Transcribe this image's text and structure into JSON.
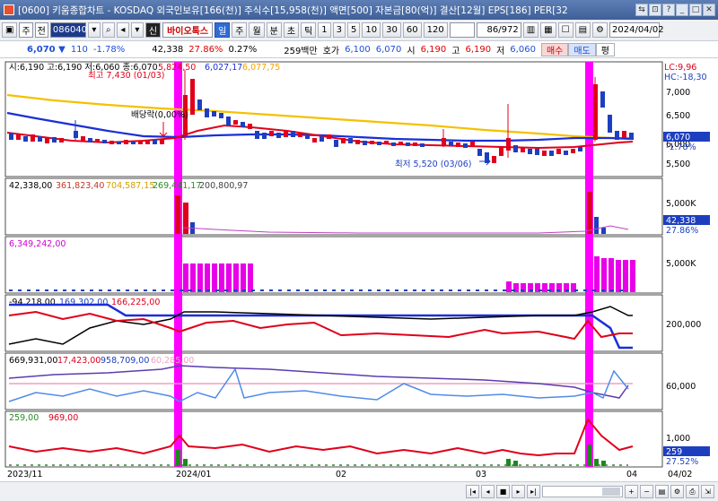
{
  "window": {
    "title": "[0600] 키움종합차트 - KOSDAQ 외국인보유[166(천)] 주식수[15,958(천)] 액면[500] 자본금[80(억)] 결산[12월] EPS[186] PER[32",
    "buttons": [
      "⇆",
      "⊡",
      "?",
      "_",
      "□",
      "✕"
    ]
  },
  "toolbar": {
    "type_select": "주",
    "period_select": "전",
    "stock_code": "086040",
    "search_icon": "search-icon",
    "stock_name": "바이오톡스",
    "tab_day": "일",
    "tab_week": "주",
    "tab_month": "월",
    "tab_minute": "분",
    "tab_second": "초",
    "tab_tick": "틱",
    "intervals": [
      "1",
      "3",
      "5",
      "10",
      "30",
      "60",
      "120"
    ],
    "counter": "86/972",
    "date": "2024/04/02"
  },
  "quote": {
    "price": "6,070 ▼",
    "change": "110",
    "change_pct": "-1.78%",
    "volume": "42,338",
    "turnover_pct": "27.86%",
    "some_pct": "0.27%",
    "amount": "259백만",
    "bid_label": "호가",
    "bid1": "6,100",
    "bid2": "6,070",
    "open_label": "시",
    "open": "6,190",
    "high_label": "고",
    "high": "6,190",
    "low_label": "저",
    "low": "6,060",
    "buy_btn": "매수",
    "sell_btn": "매도",
    "eval_btn": "평"
  },
  "price_panel": {
    "ohlc_text": "시:6,190 고:6,190 저:6,060 종:6,070",
    "ma1": "5,824,50",
    "ma2": "6,027,17",
    "ma3": "6,077,75",
    "max_label": "최고 7,430 (01/03)",
    "min_label": "최저 5,520 (03/06)",
    "dividend_label": "배당락(0,00%)",
    "lc": "LC:9,96",
    "hc": "HC:-18,30",
    "axis_ticks": [
      "7,000",
      "6,500",
      "6,000",
      "5,500"
    ],
    "current_price_tag": "6,070",
    "current_pct_tag": "-1.78%"
  },
  "volume_panel": {
    "v1": "42,338,00",
    "v2": "361,823,40",
    "v3": "704,587,15",
    "v4": "269,441,17",
    "v5": "200,800,97",
    "axis_tick": "5,000K",
    "tag_volume": "42,338",
    "tag_pct": "27.86%"
  },
  "panel3": {
    "value": "6,349,242,00",
    "axis_tick": "5,000K"
  },
  "panel4": {
    "v1": "-94,218,00",
    "v2": "169,302,00",
    "v3": "166,225,00",
    "axis_tick": "200,000"
  },
  "panel5": {
    "v1": "669,931,00",
    "v2": "17,423,00",
    "v3": "958,709,00",
    "v4": "60,285,00",
    "axis_tick": "60,000"
  },
  "panel6": {
    "v1": "259,00",
    "v2": "969,00",
    "axis_tick": "1,000",
    "tag1": "259",
    "tag2": "27.52%"
  },
  "x_axis": {
    "labels": [
      "2023/11",
      "2024/01",
      "02",
      "03",
      "04"
    ],
    "last_date": "04/02"
  },
  "colors": {
    "highlight": "#ff00ff",
    "up": "#e0001b",
    "down": "#1d3fbf",
    "ma_yellow": "#f5c000",
    "ma_blue": "#1a2fd6"
  }
}
